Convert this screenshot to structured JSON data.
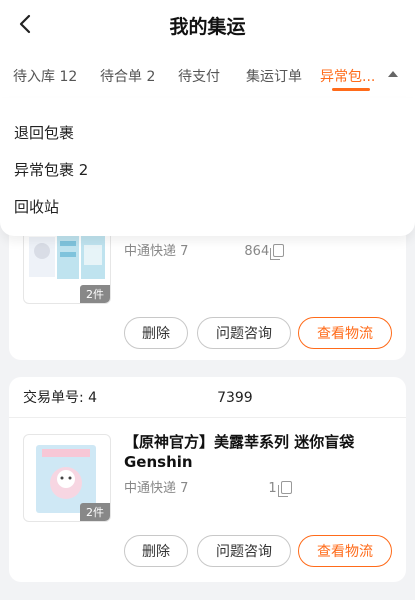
{
  "header": {
    "title": "我的集运"
  },
  "tabs": [
    {
      "label": "待入库 12"
    },
    {
      "label": "待合单 2"
    },
    {
      "label": "待支付"
    },
    {
      "label": "集运订单"
    },
    {
      "label": "异常包..."
    }
  ],
  "dropdown": {
    "items": [
      {
        "label": "退回包裹"
      },
      {
        "label": "异常包裹 2"
      },
      {
        "label": "回收站"
      }
    ]
  },
  "orders": [
    {
      "courier": "中通快递 7",
      "courier_tail": "864",
      "quantity": "2件",
      "actions": {
        "delete": "删除",
        "consult": "问题咨询",
        "logistics": "查看物流"
      }
    },
    {
      "trade_label": "交易单号: 4",
      "trade_tail": "7399",
      "product_title": "【原神官方】美露莘系列 迷你盲袋 Genshin",
      "courier": "中通快递 7",
      "courier_tail": "1",
      "quantity": "2件",
      "actions": {
        "delete": "删除",
        "consult": "问题咨询",
        "logistics": "查看物流"
      }
    }
  ],
  "colors": {
    "accent": "#ff6b1a",
    "background": "#f2f3f5"
  }
}
